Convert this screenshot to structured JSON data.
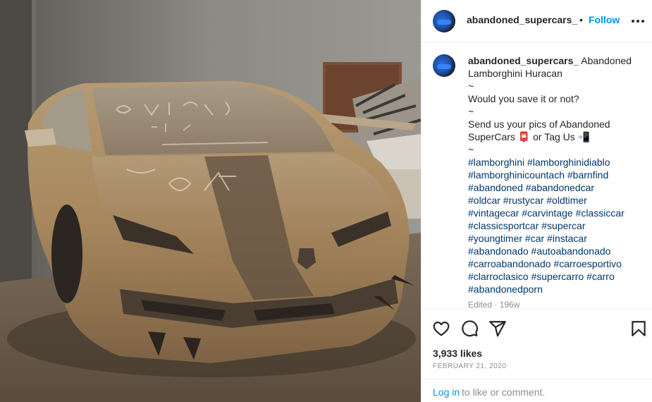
{
  "post": {
    "username": "abandoned_supercars_",
    "separator": "•",
    "follow_label": "Follow",
    "more_icon": "more-options-icon"
  },
  "caption": {
    "username": "abandoned_supercars_",
    "lines": [
      "Abandoned",
      "Lamborghini Huracan",
      "~",
      "Would you save it or not?",
      "~",
      "Send us your pics of Abandoned",
      "SuperCars 📮 or Tag Us 📲",
      "~",
      "#lamborghini #lamborghinidiablo",
      "#lamborghinicountach #barnfind",
      "#abandoned #abandonedcar",
      "#oldcar #rustycar #oldtimer",
      "#vintagecar #carvintage #classiccar",
      "#classicsportcar #supercar",
      "#youngtimer #car #instacar",
      "#abandonado #autoabandonado",
      "#carroabandonado #carroesportivo",
      "#clarroclasico #supercarro #carro",
      "#abandonedporn"
    ],
    "edited": "Edited · 196w"
  },
  "actions": {
    "like_icon": "heart-icon",
    "comment_icon": "comment-icon",
    "share_icon": "share-icon",
    "save_icon": "bookmark-icon"
  },
  "stats": {
    "likes": "3,933 likes",
    "date": "FEBRUARY 21, 2020"
  },
  "footer": {
    "login_label": "Log in",
    "login_rest": "to like or comment."
  },
  "colors": {
    "accent": "#0095f6",
    "hashtag": "#00376b",
    "muted": "#8e8e8e",
    "text": "#262626"
  }
}
